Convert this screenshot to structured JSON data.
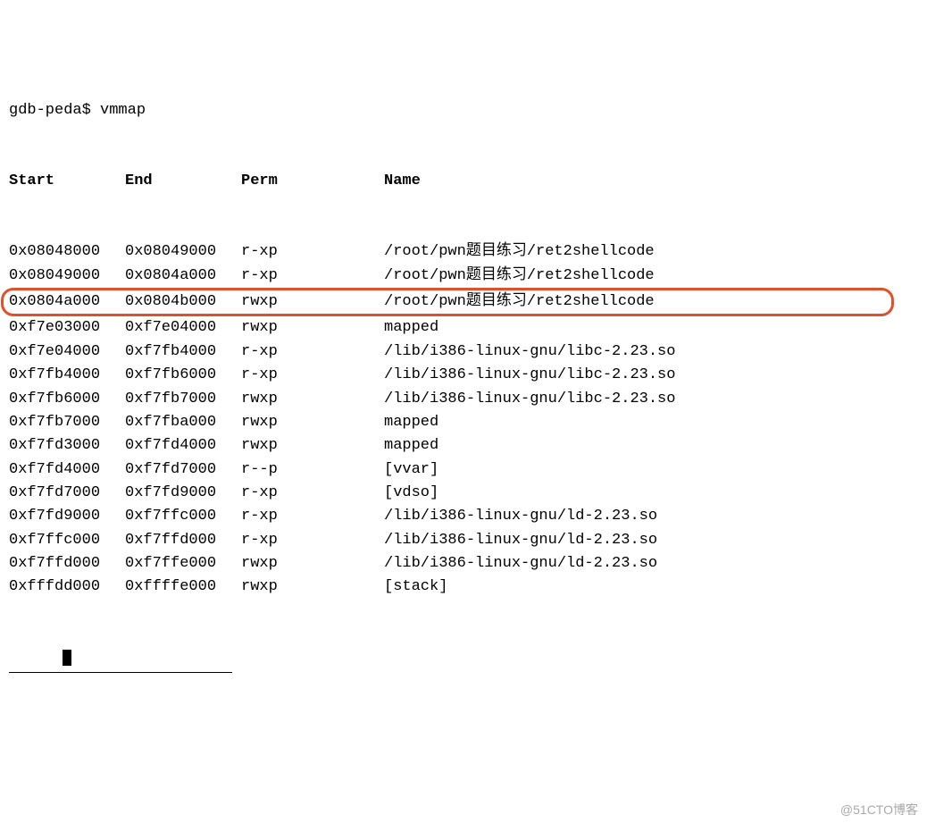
{
  "prompt": {
    "prefix": "gdb-peda$",
    "cmd": "vmmap"
  },
  "header": {
    "start": "Start",
    "end": "End",
    "perm": "Perm",
    "name": "Name"
  },
  "rows": [
    {
      "start": "0x08048000",
      "end": "0x08049000",
      "perm": "r-xp",
      "name": "/root/pwn题目练习/ret2shellcode",
      "hl": false
    },
    {
      "start": "0x08049000",
      "end": "0x0804a000",
      "perm": "r-xp",
      "name": "/root/pwn题目练习/ret2shellcode",
      "hl": false
    },
    {
      "start": "0x0804a000",
      "end": "0x0804b000",
      "perm": "rwxp",
      "name": "/root/pwn题目练习/ret2shellcode",
      "hl": true
    },
    {
      "start": "0xf7e03000",
      "end": "0xf7e04000",
      "perm": "rwxp",
      "name": "mapped",
      "hl": false
    },
    {
      "start": "0xf7e04000",
      "end": "0xf7fb4000",
      "perm": "r-xp",
      "name": "/lib/i386-linux-gnu/libc-2.23.so",
      "hl": false
    },
    {
      "start": "0xf7fb4000",
      "end": "0xf7fb6000",
      "perm": "r-xp",
      "name": "/lib/i386-linux-gnu/libc-2.23.so",
      "hl": false
    },
    {
      "start": "0xf7fb6000",
      "end": "0xf7fb7000",
      "perm": "rwxp",
      "name": "/lib/i386-linux-gnu/libc-2.23.so",
      "hl": false
    },
    {
      "start": "0xf7fb7000",
      "end": "0xf7fba000",
      "perm": "rwxp",
      "name": "mapped",
      "hl": false
    },
    {
      "start": "0xf7fd3000",
      "end": "0xf7fd4000",
      "perm": "rwxp",
      "name": "mapped",
      "hl": false
    },
    {
      "start": "0xf7fd4000",
      "end": "0xf7fd7000",
      "perm": "r--p",
      "name": "[vvar]",
      "hl": false
    },
    {
      "start": "0xf7fd7000",
      "end": "0xf7fd9000",
      "perm": "r-xp",
      "name": "[vdso]",
      "hl": false
    },
    {
      "start": "0xf7fd9000",
      "end": "0xf7ffc000",
      "perm": "r-xp",
      "name": "/lib/i386-linux-gnu/ld-2.23.so",
      "hl": false
    },
    {
      "start": "0xf7ffc000",
      "end": "0xf7ffd000",
      "perm": "r-xp",
      "name": "/lib/i386-linux-gnu/ld-2.23.so",
      "hl": false
    },
    {
      "start": "0xf7ffd000",
      "end": "0xf7ffe000",
      "perm": "rwxp",
      "name": "/lib/i386-linux-gnu/ld-2.23.so",
      "hl": false
    },
    {
      "start": "0xfffdd000",
      "end": "0xffffe000",
      "perm": "rwxp",
      "name": "[stack]",
      "hl": false
    }
  ],
  "watermark": "@51CTO博客"
}
